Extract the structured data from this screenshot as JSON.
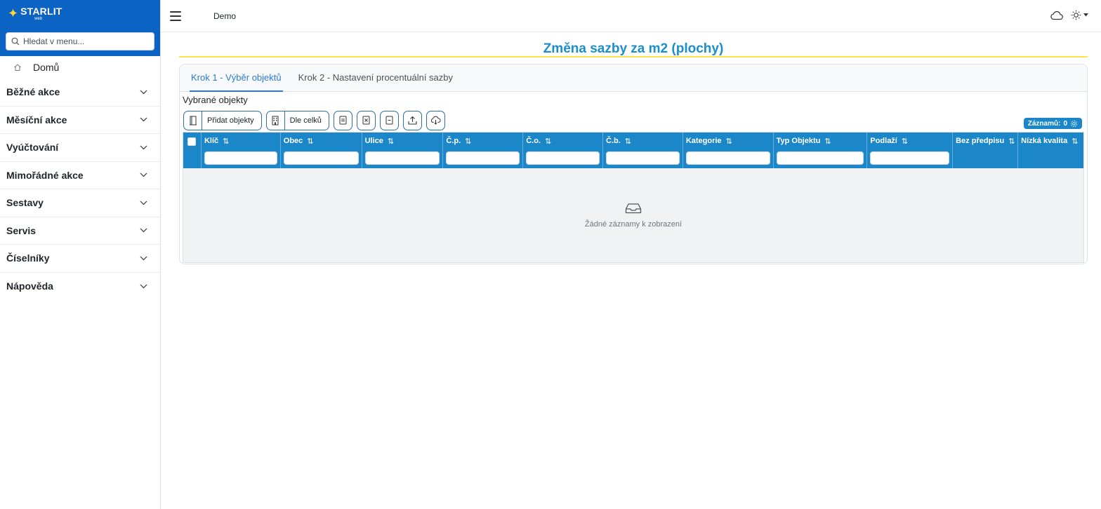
{
  "brand": {
    "name": "STARLIT",
    "sub": "web"
  },
  "search": {
    "placeholder": "Hledat v menu..."
  },
  "sidebar": {
    "home_label": "Domů",
    "groups": [
      {
        "label": "Běžné akce"
      },
      {
        "label": "Měsíční akce"
      },
      {
        "label": "Vyúčtování"
      },
      {
        "label": "Mimořádné akce"
      },
      {
        "label": "Sestavy"
      },
      {
        "label": "Servis"
      },
      {
        "label": "Číselníky"
      },
      {
        "label": "Nápověda"
      }
    ]
  },
  "topbar": {
    "breadcrumb": "Demo"
  },
  "page": {
    "title": "Změna sazby za m2 (plochy)",
    "tabs": [
      {
        "label": "Krok 1 - Výběr objektů",
        "active": true
      },
      {
        "label": "Krok 2 - Nastavení procentuální sazby",
        "active": false
      }
    ],
    "section_title": "Vybrané objekty"
  },
  "toolbar": {
    "add_objects_label": "Přidat objekty",
    "by_units_label": "Dle celků"
  },
  "records": {
    "label": "Záznamů:",
    "count": "0"
  },
  "table": {
    "columns": [
      {
        "label": "Klíč"
      },
      {
        "label": "Obec"
      },
      {
        "label": "Ulice"
      },
      {
        "label": "Č.p."
      },
      {
        "label": "Č.o."
      },
      {
        "label": "Č.b."
      },
      {
        "label": "Kategorie"
      },
      {
        "label": "Typ Objektu"
      },
      {
        "label": "Podlaží"
      },
      {
        "label": "Bez předpisu"
      },
      {
        "label": "Nízká kvalita"
      }
    ],
    "empty_message": "Žádné záznamy k zobrazení"
  },
  "colors": {
    "brand_blue": "#0b63c4",
    "accent_blue": "#1b86c8",
    "title_blue": "#1b8fcb",
    "underline_yellow": "#ffe34a"
  }
}
